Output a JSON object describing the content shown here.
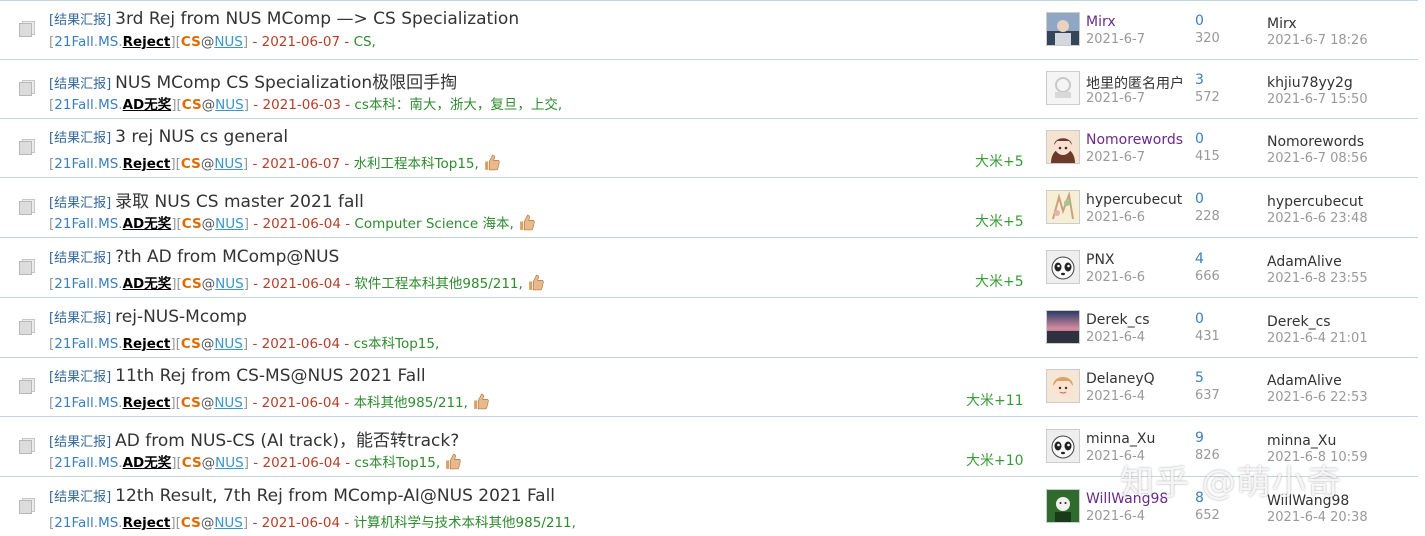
{
  "threads": [
    {
      "category": "[结果汇报]",
      "title": "3rd Rej from NUS MComp —> CS Specialization",
      "year": "21Fall",
      "degree": "MS",
      "result": "Reject",
      "field": "CS",
      "school": "NUS",
      "date": "2021-06-07",
      "tags": "CS,",
      "reward": "",
      "author": "Mirx",
      "author_purple": true,
      "author_date": "2021-6-7",
      "replies": "0",
      "views": "320",
      "last_poster": "Mirx",
      "last_date": "2021-6-7 18:26",
      "avatar": "avatar-photo"
    },
    {
      "category": "[结果汇报]",
      "title": "NUS MComp CS Specialization极限回手掏",
      "year": "21Fall",
      "degree": "MS",
      "result": "AD无奖",
      "field": "CS",
      "school": "NUS",
      "date": "2021-06-03",
      "tags": "cs本科：南大，浙大，复旦，上交,",
      "reward": "",
      "author": "地里的匿名用户",
      "author_purple": false,
      "author_date": "2021-6-7",
      "replies": "3",
      "views": "572",
      "last_poster": "khjiu78yy2g",
      "last_date": "2021-6-7 15:50",
      "avatar": "anon"
    },
    {
      "category": "[结果汇报]",
      "title": "3 rej NUS cs general",
      "year": "21Fall",
      "degree": "MS",
      "result": "Reject",
      "field": "CS",
      "school": "NUS",
      "date": "2021-06-07",
      "tags": "水利工程本科Top15,",
      "reward": "大米+5",
      "author": "Nomorewords",
      "author_purple": true,
      "author_date": "2021-6-7",
      "replies": "0",
      "views": "415",
      "last_poster": "Nomorewords",
      "last_date": "2021-6-7 08:56",
      "avatar": "anime"
    },
    {
      "category": "[结果汇报]",
      "title": "录取 NUS CS master 2021 fall",
      "year": "21Fall",
      "degree": "MS",
      "result": "AD无奖",
      "field": "CS",
      "school": "NUS",
      "date": "2021-06-04",
      "tags": "Computer Science 海本,",
      "reward": "大米+5",
      "author": "hypercubecut",
      "author_purple": false,
      "author_date": "2021-6-6",
      "replies": "0",
      "views": "228",
      "last_poster": "hypercubecut",
      "last_date": "2021-6-6 23:48",
      "avatar": "sketch"
    },
    {
      "category": "[结果汇报]",
      "title": "?th AD from MComp@NUS",
      "year": "21Fall",
      "degree": "MS",
      "result": "AD无奖",
      "field": "CS",
      "school": "NUS",
      "date": "2021-06-04",
      "tags": "软件工程本科其他985/211,",
      "reward": "大米+5",
      "author": "PNX",
      "author_purple": false,
      "author_date": "2021-6-6",
      "replies": "4",
      "views": "666",
      "last_poster": "AdamAlive",
      "last_date": "2021-6-8 23:55",
      "avatar": "panda"
    },
    {
      "category": "[结果汇报]",
      "title": "rej-NUS-Mcomp",
      "year": "21Fall",
      "degree": "MS",
      "result": "Reject",
      "field": "CS",
      "school": "NUS",
      "date": "2021-06-04",
      "tags": "cs本科Top15,",
      "reward": "",
      "author": "Derek_cs",
      "author_purple": false,
      "author_date": "2021-6-4",
      "replies": "0",
      "views": "431",
      "last_poster": "Derek_cs",
      "last_date": "2021-6-4 21:01",
      "avatar": "sky"
    },
    {
      "category": "[结果汇报]",
      "title": "11th Rej from CS-MS@NUS 2021 Fall",
      "year": "21Fall",
      "degree": "MS",
      "result": "Reject",
      "field": "CS",
      "school": "NUS",
      "date": "2021-06-04",
      "tags": "本科其他985/211,",
      "reward": "大米+11",
      "author": "DelaneyQ",
      "author_purple": false,
      "author_date": "2021-6-4",
      "replies": "5",
      "views": "637",
      "last_poster": "AdamAlive",
      "last_date": "2021-6-6 22:53",
      "avatar": "cartoon"
    },
    {
      "category": "[结果汇报]",
      "title": "AD from NUS-CS (AI track)，能否转track?",
      "year": "21Fall",
      "degree": "MS",
      "result": "AD无奖",
      "field": "CS",
      "school": "NUS",
      "date": "2021-06-04",
      "tags": "cs本科Top15,",
      "reward": "大米+10",
      "author": "minna_Xu",
      "author_purple": false,
      "author_date": "2021-6-4",
      "replies": "9",
      "views": "826",
      "last_poster": "minna_Xu",
      "last_date": "2021-6-8 10:59",
      "avatar": "panda"
    },
    {
      "category": "[结果汇报]",
      "title": "12th Result, 7th Rej from MComp-AI@NUS 2021 Fall",
      "year": "21Fall",
      "degree": "MS",
      "result": "Reject",
      "field": "CS",
      "school": "NUS",
      "date": "2021-06-04",
      "tags": "计算机科学与技术本科其他985/211,",
      "reward": "",
      "author": "WillWang98",
      "author_purple": true,
      "author_date": "2021-6-4",
      "replies": "8",
      "views": "652",
      "last_poster": "WillWang98",
      "last_date": "2021-6-4 20:38",
      "avatar": "green"
    }
  ],
  "watermark": "知乎 @萌小奇",
  "colors": {
    "category": "#336699",
    "result_field": "#e06b00",
    "date": "#b5402a",
    "tags": "#2e8b2e",
    "reward": "#3a9a3a",
    "border": "#c2d5e3"
  }
}
